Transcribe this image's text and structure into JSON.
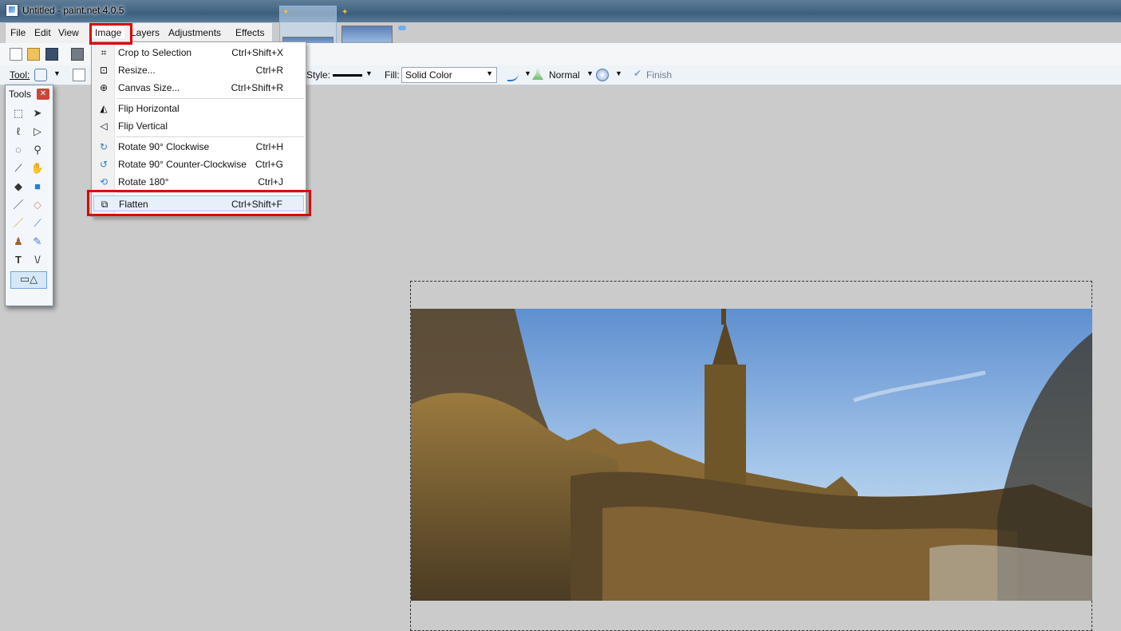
{
  "window": {
    "title": "Untitled - paint.net 4.0.5"
  },
  "menubar": {
    "items": [
      "File",
      "Edit",
      "View",
      "Image",
      "Layers",
      "Adjustments",
      "Effects"
    ]
  },
  "toolbar": {
    "tool_label": "Tool:",
    "style_label": "Style:",
    "fill_label": "Fill:",
    "fill_value": "Solid Color",
    "blend_value": "Normal",
    "finish_label": "Finish"
  },
  "tools_window": {
    "title": "Tools"
  },
  "image_menu": {
    "items": [
      {
        "label": "Crop to Selection",
        "shortcut": "Ctrl+Shift+X",
        "icon": "crop-icon"
      },
      {
        "label": "Resize...",
        "shortcut": "Ctrl+R",
        "icon": "resize-icon"
      },
      {
        "label": "Canvas Size...",
        "shortcut": "Ctrl+Shift+R",
        "icon": "canvas-size-icon"
      },
      {
        "label": "Flip Horizontal",
        "shortcut": "",
        "icon": "flip-horizontal-icon"
      },
      {
        "label": "Flip Vertical",
        "shortcut": "",
        "icon": "flip-vertical-icon"
      },
      {
        "label": "Rotate 90° Clockwise",
        "shortcut": "Ctrl+H",
        "icon": "rotate-cw-icon"
      },
      {
        "label": "Rotate 90° Counter-Clockwise",
        "shortcut": "Ctrl+G",
        "icon": "rotate-ccw-icon"
      },
      {
        "label": "Rotate 180°",
        "shortcut": "Ctrl+J",
        "icon": "rotate-180-icon"
      },
      {
        "label": "Flatten",
        "shortcut": "Ctrl+Shift+F",
        "icon": "flatten-icon"
      }
    ]
  },
  "highlight_color": "#e00000"
}
